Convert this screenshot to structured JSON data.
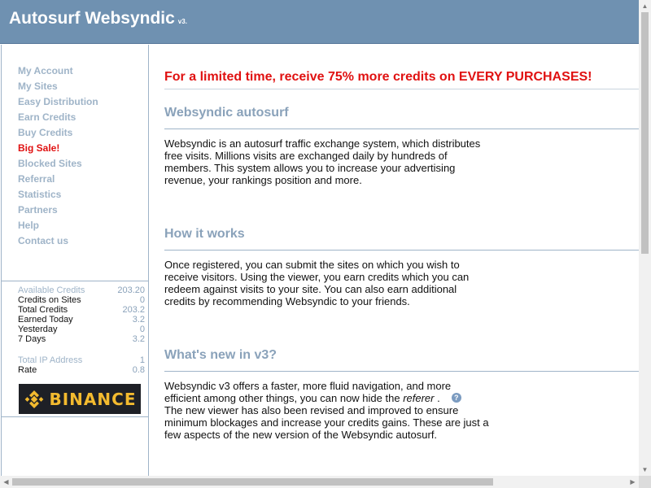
{
  "header": {
    "title": "Autosurf Websyndic",
    "version": "v3."
  },
  "sidebar": {
    "items": [
      {
        "label": "My Account"
      },
      {
        "label": "My Sites"
      },
      {
        "label": "Easy Distribution"
      },
      {
        "label": "Earn Credits"
      },
      {
        "label": "Buy Credits"
      },
      {
        "label": "Big Sale!"
      },
      {
        "label": "Blocked Sites"
      },
      {
        "label": "Referral"
      },
      {
        "label": "Statistics"
      },
      {
        "label": "Partners"
      },
      {
        "label": "Help"
      },
      {
        "label": "Contact us"
      }
    ],
    "stats": [
      {
        "label": "Available Credits",
        "value": "203.20"
      },
      {
        "label": "Credits on Sites",
        "value": "0"
      },
      {
        "label": "Total Credits",
        "value": "203.2"
      },
      {
        "label": "Earned Today",
        "value": "3.2"
      },
      {
        "label": "Yesterday",
        "value": "0"
      },
      {
        "label": "7 Days",
        "value": "3.2"
      },
      {
        "label": "Total IP Address",
        "value": "1"
      },
      {
        "label": "Rate",
        "value": "0.8"
      }
    ],
    "banner_text": "BINANCE"
  },
  "main": {
    "promo": "For a limited time, receive 75% more credits on EVERY PURCHASES!",
    "sections": [
      {
        "heading": "Websyndic autosurf",
        "text": "Websyndic is an autosurf traffic exchange system, which distributes free visits. Millions visits are exchanged daily by hundreds of members. This system allows you to increase your advertising revenue, your rankings position and more."
      },
      {
        "heading": "How it works",
        "text": "Once registered, you can submit the sites on which you wish to receive visitors. Using the viewer, you earn credits which you can redeem against visits to your site. You can also earn additional credits by recommending Websyndic to your friends."
      },
      {
        "heading": "What's new in v3?",
        "text_before": "Websyndic v3 offers a faster, more fluid navigation, and more efficient among other things, you can now hide the",
        "text_em": "referer",
        "text_dot": " .",
        "text_after": "The new viewer has also been revised and improved to ensure minimum blockages and increase your credits gains. These are just a few aspects of the new version of the Websyndic autosurf."
      }
    ]
  }
}
